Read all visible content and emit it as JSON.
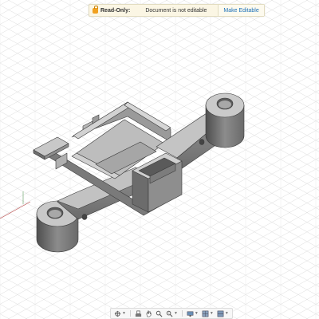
{
  "banner": {
    "title": "Read-Only:",
    "message": "Document is not editable",
    "action": "Make Editable"
  },
  "toolbar": {
    "buttons": [
      {
        "name": "orbit-icon",
        "has_menu": true
      },
      {
        "name": "look-at-icon",
        "has_menu": false
      },
      {
        "name": "pan-hand-icon",
        "has_menu": false
      },
      {
        "name": "zoom-icon",
        "has_menu": false
      },
      {
        "name": "zoom-window-icon",
        "has_menu": true
      },
      {
        "name": "display-settings-icon",
        "has_menu": true
      },
      {
        "name": "grid-settings-icon",
        "has_menu": true
      },
      {
        "name": "viewports-icon",
        "has_menu": true
      }
    ]
  },
  "colors": {
    "grid": "#d6d6d6",
    "part_top": "#c4c4c4",
    "part_side": "#8a8a8a",
    "part_dark": "#5e5e5e",
    "edge": "#3a3a3a"
  }
}
